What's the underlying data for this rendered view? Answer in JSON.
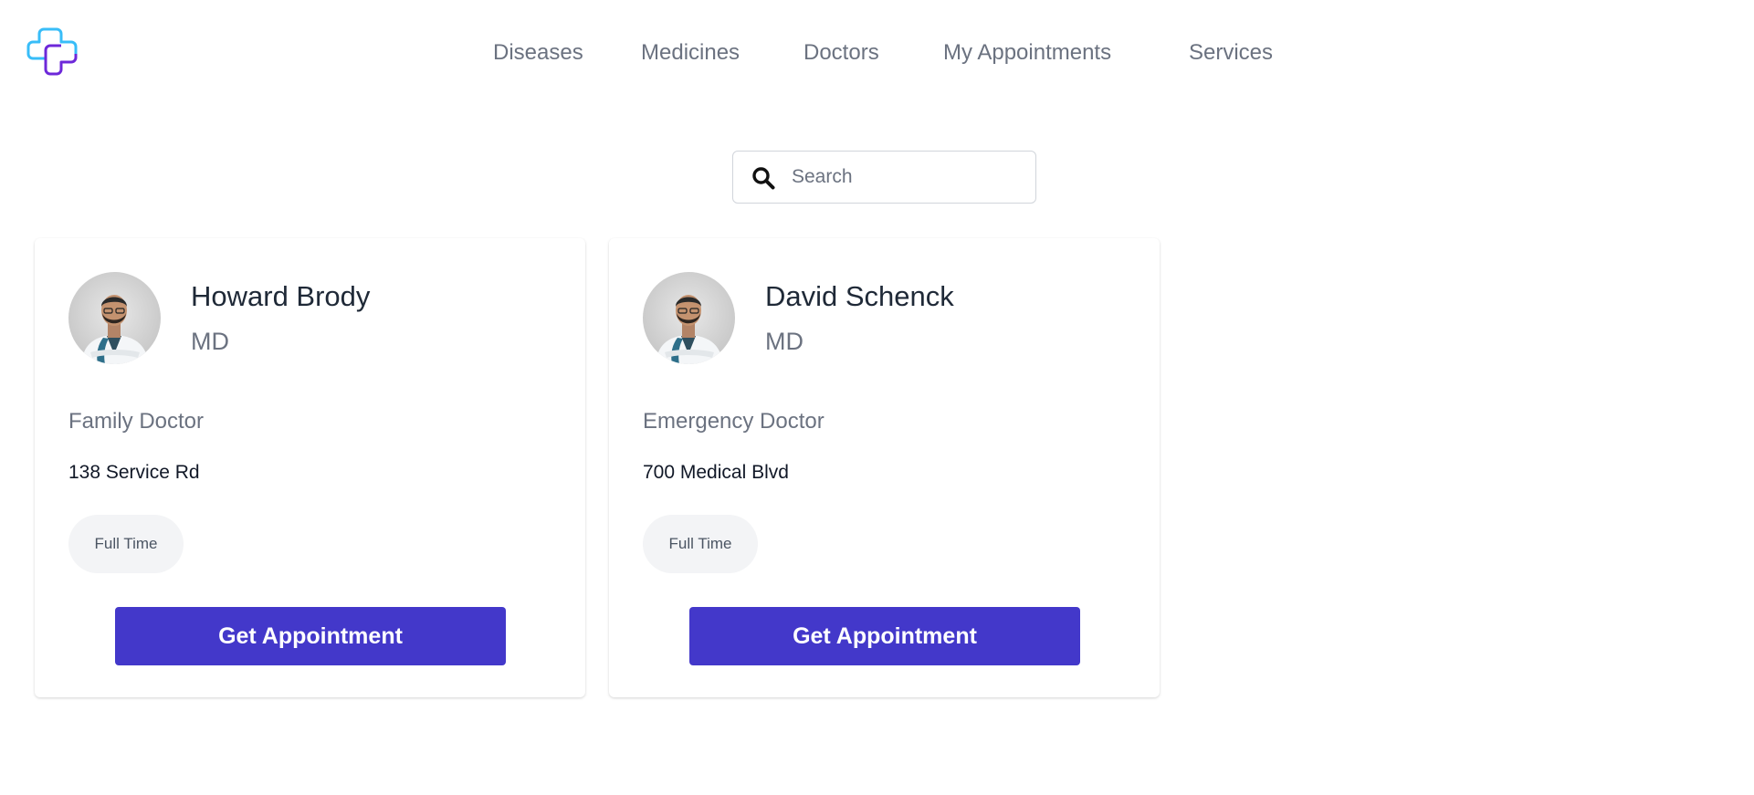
{
  "header": {
    "logo_icon": "medical-cross-logo-icon",
    "nav": [
      {
        "label": "Diseases"
      },
      {
        "label": "Medicines"
      },
      {
        "label": "Doctors"
      },
      {
        "label": "My Appointments"
      },
      {
        "label": "Services"
      }
    ]
  },
  "search": {
    "placeholder": "Search",
    "value": "",
    "icon": "search-icon"
  },
  "doctors": [
    {
      "name": "Howard Brody",
      "degree": "MD",
      "specialty": "Family Doctor",
      "address": "138 Service Rd",
      "badge": "Full Time",
      "button_label": "Get Appointment"
    },
    {
      "name": "David Schenck",
      "degree": "MD",
      "specialty": "Emergency Doctor",
      "address": "700 Medical Blvd",
      "badge": "Full Time",
      "button_label": "Get Appointment"
    }
  ],
  "colors": {
    "accent": "#4338ca",
    "logo_cyan": "#38bdf8",
    "logo_purple": "#6d28d9",
    "muted_text": "#6b7280",
    "badge_bg": "#f3f4f6"
  }
}
